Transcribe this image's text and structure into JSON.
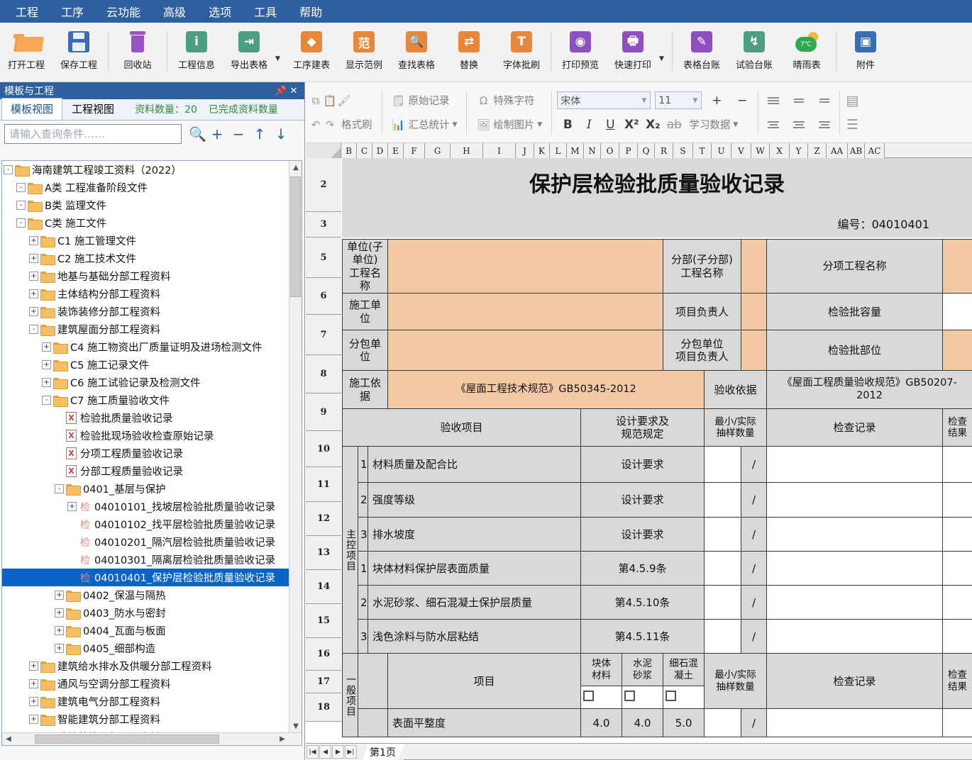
{
  "menubar": {
    "items": [
      "工程",
      "工序",
      "云功能",
      "高级",
      "选项",
      "工具",
      "帮助"
    ]
  },
  "ribbon": {
    "items": [
      {
        "label": "打开工程",
        "icon": "open-folder-icon"
      },
      {
        "label": "保存工程",
        "icon": "save-disk-icon"
      },
      {
        "label": "回收站",
        "icon": "trash-icon"
      },
      {
        "label": "工程信息",
        "icon": "info-icon"
      },
      {
        "label": "导出表格",
        "icon": "export-table-icon"
      },
      {
        "label": "工序建表",
        "icon": "layers-icon"
      },
      {
        "label": "显示范例",
        "icon": "sample-icon",
        "glyph": "范"
      },
      {
        "label": "查找表格",
        "icon": "search-table-icon"
      },
      {
        "label": "替换",
        "icon": "replace-icon"
      },
      {
        "label": "字体批刷",
        "icon": "font-brush-icon"
      },
      {
        "label": "打印预览",
        "icon": "print-preview-icon"
      },
      {
        "label": "快速打印",
        "icon": "quick-print-icon"
      },
      {
        "label": "表格台账",
        "icon": "table-ledger-icon"
      },
      {
        "label": "试验台账",
        "icon": "test-ledger-icon"
      },
      {
        "label": "晴雨表",
        "icon": "weather-icon"
      },
      {
        "label": "附件",
        "icon": "attachment-icon"
      }
    ]
  },
  "leftpanel": {
    "title": "模板与工程",
    "pin_icon": "pin-icon",
    "close_icon": "close-icon",
    "tabs": [
      {
        "label": "模板视图",
        "active": true
      },
      {
        "label": "工程视图",
        "active": false
      }
    ],
    "stat_count": "资料数量：20",
    "stat_done": "已完成资料数量",
    "search_placeholder": "请输入查询条件……",
    "search_value": "",
    "toolbar_icons": [
      "search-icon",
      "add-icon",
      "remove-icon",
      "move-up-icon",
      "move-down-icon"
    ],
    "tree": [
      {
        "depth": 0,
        "plug": "-",
        "icon": "folder",
        "label": "海南建筑工程竣工资料（2022）",
        "selected": false
      },
      {
        "depth": 1,
        "plug": "-",
        "icon": "folder",
        "label": "A类 工程准备阶段文件",
        "selected": false
      },
      {
        "depth": 1,
        "plug": "-",
        "icon": "folder",
        "label": "B类 监理文件",
        "selected": false
      },
      {
        "depth": 1,
        "plug": "-",
        "icon": "folder",
        "label": "C类 施工文件",
        "selected": false
      },
      {
        "depth": 2,
        "plug": "+",
        "icon": "folder",
        "label": "C1 施工管理文件",
        "selected": false
      },
      {
        "depth": 2,
        "plug": "+",
        "icon": "folder",
        "label": "C2 施工技术文件",
        "selected": false
      },
      {
        "depth": 2,
        "plug": "+",
        "icon": "folder",
        "label": "地基与基础分部工程资料",
        "selected": false
      },
      {
        "depth": 2,
        "plug": "+",
        "icon": "folder",
        "label": "主体结构分部工程资料",
        "selected": false
      },
      {
        "depth": 2,
        "plug": "+",
        "icon": "folder",
        "label": "装饰装修分部工程资料",
        "selected": false
      },
      {
        "depth": 2,
        "plug": "-",
        "icon": "folder",
        "label": "建筑屋面分部工程资料",
        "selected": false
      },
      {
        "depth": 3,
        "plug": "+",
        "icon": "folder",
        "label": "C4 施工物资出厂质量证明及进场检测文件",
        "selected": false
      },
      {
        "depth": 3,
        "plug": "+",
        "icon": "folder",
        "label": "C5 施工记录文件",
        "selected": false
      },
      {
        "depth": 3,
        "plug": "+",
        "icon": "folder",
        "label": "C6 施工试验记录及检测文件",
        "selected": false
      },
      {
        "depth": 3,
        "plug": "-",
        "icon": "folder",
        "label": "C7 施工质量验收文件",
        "selected": false
      },
      {
        "depth": 4,
        "plug": "",
        "icon": "doc",
        "label": "检验批质量验收记录",
        "selected": false
      },
      {
        "depth": 4,
        "plug": "",
        "icon": "doc",
        "label": "检验批现场验收检查原始记录",
        "selected": false
      },
      {
        "depth": 4,
        "plug": "",
        "icon": "doc",
        "label": "分项工程质量验收记录",
        "selected": false
      },
      {
        "depth": 4,
        "plug": "",
        "icon": "doc",
        "label": "分部工程质量验收记录",
        "selected": false
      },
      {
        "depth": 4,
        "plug": "-",
        "icon": "folder",
        "label": "0401_基层与保护",
        "selected": false
      },
      {
        "depth": 5,
        "plug": "+",
        "icon": "check",
        "label": "04010101_找坡层检验批质量验收记录",
        "selected": false
      },
      {
        "depth": 5,
        "plug": "",
        "icon": "check",
        "label": "04010102_找平层检验批质量验收记录",
        "selected": false
      },
      {
        "depth": 5,
        "plug": "",
        "icon": "check",
        "label": "04010201_隔汽层检验批质量验收记录",
        "selected": false
      },
      {
        "depth": 5,
        "plug": "",
        "icon": "check",
        "label": "04010301_隔离层检验批质量验收记录",
        "selected": false
      },
      {
        "depth": 5,
        "plug": "",
        "icon": "check",
        "label": "04010401_保护层检验批质量验收记录",
        "selected": true
      },
      {
        "depth": 4,
        "plug": "+",
        "icon": "folder",
        "label": "0402_保温与隔热",
        "selected": false
      },
      {
        "depth": 4,
        "plug": "+",
        "icon": "folder",
        "label": "0403_防水与密封",
        "selected": false
      },
      {
        "depth": 4,
        "plug": "+",
        "icon": "folder",
        "label": "0404_瓦面与板面",
        "selected": false
      },
      {
        "depth": 4,
        "plug": "+",
        "icon": "folder",
        "label": "0405_细部构造",
        "selected": false
      },
      {
        "depth": 2,
        "plug": "+",
        "icon": "folder",
        "label": "建筑给水排水及供暖分部工程资料",
        "selected": false
      },
      {
        "depth": 2,
        "plug": "+",
        "icon": "folder",
        "label": "通风与空调分部工程资料",
        "selected": false
      },
      {
        "depth": 2,
        "plug": "+",
        "icon": "folder",
        "label": "建筑电气分部工程资料",
        "selected": false
      },
      {
        "depth": 2,
        "plug": "+",
        "icon": "folder",
        "label": "智能建筑分部工程资料",
        "selected": false
      },
      {
        "depth": 2,
        "plug": "+",
        "icon": "folder",
        "label": "建筑节能分部工程资料",
        "selected": false
      }
    ]
  },
  "formatbar": {
    "copy_icon": "copy-icon",
    "paste_icon": "paste-icon",
    "brush_icon": "format-brush-icon",
    "undo_icon": "undo-icon",
    "redo_icon": "redo-icon",
    "brush_label": "格式刷",
    "orig_record_label": "原始记录",
    "summary_label": "汇总统计",
    "special_char_label": "特殊字符",
    "draw_image_label": "绘制图片",
    "font_family": "宋体",
    "font_size": "11",
    "increase_icon": "increase-font-icon",
    "decrease_icon": "decrease-font-icon",
    "bold": "B",
    "italic": "I",
    "underline": "U",
    "superscript": "X²",
    "subscript": "X₂",
    "strikethrough": "ab",
    "learn_data_label": "学习数据"
  },
  "sheet": {
    "columns": [
      "B",
      "C",
      "D",
      "E",
      "F",
      "G",
      "H",
      "I",
      "J",
      "K",
      "L",
      "M",
      "N",
      "O",
      "P",
      "Q",
      "R",
      "S",
      "T",
      "U",
      "V",
      "W",
      "X",
      "Y",
      "Z",
      "AA",
      "AB",
      "AC"
    ],
    "rows": [
      "2",
      "3",
      "5",
      "6",
      "7",
      "8",
      "9",
      "10",
      "11",
      "12",
      "13",
      "14",
      "15",
      "16",
      "17",
      "18"
    ],
    "tabbar": {
      "nav_first": "|◀",
      "nav_prev": "◀",
      "nav_next": "▶",
      "nav_last": "▶|",
      "sheet_name": "第1页"
    }
  },
  "document": {
    "title": "保护层检验批质量验收记录",
    "number_label": "编号：",
    "number_value": "04010401",
    "fields": {
      "unit_project_label": "单位(子单位)\n工程名称",
      "unit_project_value": "",
      "division_label": "分部(子分部)\n工程名称",
      "division_value": "",
      "subitem_label": "分项工程名称",
      "subitem_value": "",
      "construction_unit_label": "施工单位",
      "construction_unit_value": "",
      "project_leader_label": "项目负责人",
      "project_leader_value": "",
      "batch_capacity_label": "检验批容量",
      "batch_capacity_value": "",
      "subcontractor_label": "分包单位",
      "subcontractor_value": "",
      "sub_leader_label": "分包单位\n项目负责人",
      "sub_leader_value": "",
      "batch_part_label": "检验批部位",
      "batch_part_value": "",
      "construction_basis_label": "施工依据",
      "construction_basis_value": "《屋面工程技术规范》GB50345-2012",
      "acceptance_basis_label": "验收依据",
      "acceptance_basis_value": "《屋面工程质量验收规范》GB50207-2012"
    },
    "table_headers": {
      "item": "验收项目",
      "spec": "设计要求及\n规范规定",
      "sample": "最小/实际\n抽样数量",
      "record": "检查记录",
      "result": "检查\n结果"
    },
    "sections": [
      {
        "name": "主控项目",
        "rows": [
          {
            "no": "1",
            "item": "材料质量及配合比",
            "spec": "设计要求",
            "sample": "/",
            "record": "",
            "result": ""
          },
          {
            "no": "2",
            "item": "强度等级",
            "spec": "设计要求",
            "sample": "/",
            "record": "",
            "result": ""
          },
          {
            "no": "3",
            "item": "排水坡度",
            "spec": "设计要求",
            "sample": "/",
            "record": "",
            "result": ""
          },
          {
            "no": "1",
            "item": "块体材料保护层表面质量",
            "spec": "第4.5.9条",
            "sample": "/",
            "record": "",
            "result": ""
          },
          {
            "no": "2",
            "item": "水泥砂浆、细石混凝土保护层质量",
            "spec": "第4.5.10条",
            "sample": "/",
            "record": "",
            "result": ""
          },
          {
            "no": "3",
            "item": "浅色涂料与防水层粘结",
            "spec": "第4.5.11条",
            "sample": "/",
            "record": "",
            "result": ""
          }
        ]
      },
      {
        "name": "一般项目",
        "sub_headers": {
          "item": "项目",
          "col1": "块体\n材料",
          "col2": "水泥\n砂浆",
          "col3": "细石混\n凝土",
          "sample": "最小/实际\n抽样数量",
          "record": "检查记录",
          "result": "检查\n结果"
        },
        "rows": [
          {
            "item": "表面平整度",
            "col1": "4.0",
            "col2": "4.0",
            "col3": "5.0",
            "sample": "/",
            "record": "",
            "result": ""
          }
        ]
      }
    ]
  }
}
